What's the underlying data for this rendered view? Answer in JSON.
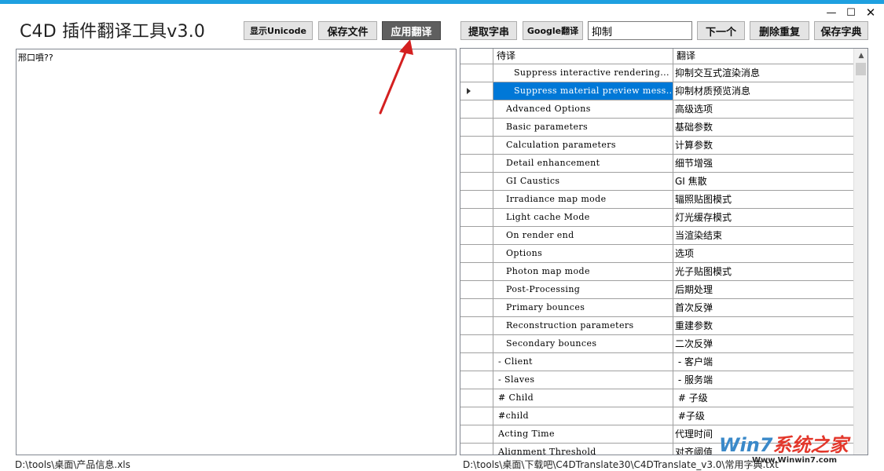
{
  "window": {
    "title": "C4D 插件翻译工具v3.0",
    "minimize_glyph": "—",
    "maximize_glyph": "☐",
    "close_glyph": "✕"
  },
  "toolbar": {
    "show_unicode": "显示Unicode",
    "save_file": "保存文件",
    "apply_translate": "应用翻译",
    "extract_strings": "提取字串",
    "google_translate": "Google翻译",
    "search_value": "抑制",
    "next": "下一个",
    "remove_duplicates": "删除重复",
    "save_dictionary": "保存字典"
  },
  "editor": {
    "content": "邢口噴??"
  },
  "grid": {
    "columns": [
      "待译",
      "翻译"
    ],
    "selected_index": 1,
    "rows": [
      {
        "source": "  Suppress interactive rendering...",
        "target": "抑制交互式渲染消息"
      },
      {
        "source": "  Suppress material preview mess...",
        "target": "抑制材质预览消息"
      },
      {
        "source": " Advanced Options",
        "target": "高级选项"
      },
      {
        "source": " Basic parameters",
        "target": "基础参数"
      },
      {
        "source": " Calculation parameters",
        "target": "计算参数"
      },
      {
        "source": " Detail enhancement",
        "target": "细节增强"
      },
      {
        "source": " GI Caustics",
        "target": "GI 焦散"
      },
      {
        "source": " Irradiance map mode",
        "target": "辐照贴图模式"
      },
      {
        "source": " Light cache Mode",
        "target": "灯光缓存模式"
      },
      {
        "source": " On render end",
        "target": "当渲染结束"
      },
      {
        "source": " Options",
        "target": "选项"
      },
      {
        "source": " Photon map mode",
        "target": "光子贴图模式"
      },
      {
        "source": " Post-Processing",
        "target": "后期处理"
      },
      {
        "source": " Primary bounces",
        "target": "首次反弹"
      },
      {
        "source": " Reconstruction parameters",
        "target": "重建参数"
      },
      {
        "source": " Secondary bounces",
        "target": "二次反弹"
      },
      {
        "source": "- Client",
        "target": " - 客户端"
      },
      {
        "source": "- Slaves",
        "target": " - 服务端"
      },
      {
        "source": "# Child",
        "target": " # 子级"
      },
      {
        "source": "#child",
        "target": " #子级"
      },
      {
        "source": "Acting Time",
        "target": "代理时间"
      },
      {
        "source": "Alignment Threshold",
        "target": "对齐阈值"
      }
    ]
  },
  "status": {
    "left_path": "D:\\tools\\桌面\\产品信息.xls",
    "right_path": "D:\\tools\\桌面\\下载吧\\C4DTranslate30\\C4DTranslate_v3.0\\常用字典.txt"
  },
  "watermark": {
    "logo_prefix": "Win7",
    "logo_suffix": "系统之家",
    "url": "Www.Winwin7.com"
  },
  "colors": {
    "accent": "#1ea0e0",
    "selection": "#0078d7",
    "annotation_arrow": "#d42020"
  }
}
